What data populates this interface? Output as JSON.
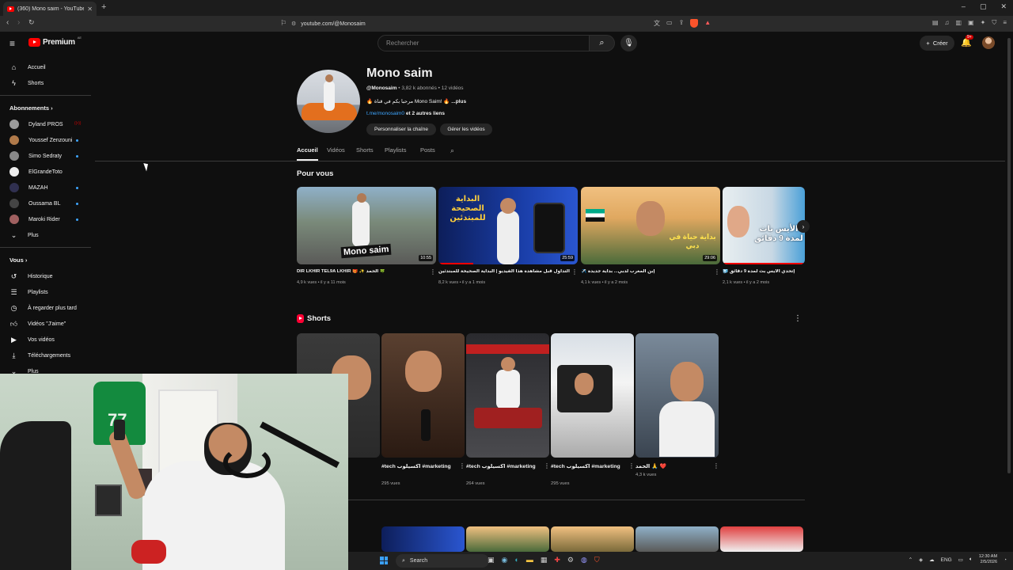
{
  "browser": {
    "tab_title": "(360) Mono saim - YouTube",
    "url": "youtube.com/@Monosaim",
    "notif_badge": "9+"
  },
  "header": {
    "logo_word": "Premium",
    "logo_country": "AE",
    "search_placeholder": "Rechercher",
    "create_label": "Créer",
    "bell_badge": "9+"
  },
  "sidebar": {
    "home": "Accueil",
    "shorts": "Shorts",
    "subscriptions_title": "Abonnements",
    "channels": [
      {
        "name": "Dyland PROS",
        "status": "live"
      },
      {
        "name": "Youssef Zenzouni",
        "status": "dot"
      },
      {
        "name": "Simo Sedraty",
        "status": "dot"
      },
      {
        "name": "ElGrandeToto",
        "status": "none"
      },
      {
        "name": "MAZAH",
        "status": "dot"
      },
      {
        "name": "Oussama BL",
        "status": "dot"
      },
      {
        "name": "Maroki Rider",
        "status": "dot"
      }
    ],
    "more_subs": "Plus",
    "you_title": "Vous",
    "you_items": [
      "Historique",
      "Playlists",
      "À regarder plus tard",
      "Vidéos \"J'aime\"",
      "Vos vidéos",
      "Téléchargements"
    ],
    "more_you": "Plus"
  },
  "channel": {
    "name": "Mono saim",
    "handle": "@Monosaim",
    "subs": "3,82 k abonnés",
    "videos": "12 vidéos",
    "desc": "مرحبا بكم في قناة Mono Saim!",
    "more": "...plus",
    "link": "t.me/monosaim0",
    "other_links": "et 2 autres liens",
    "btn_customize": "Personnaliser la chaîne",
    "btn_manage": "Gérer les vidéos",
    "tabs": [
      "Accueil",
      "Vidéos",
      "Shorts",
      "Playlists",
      "Posts"
    ]
  },
  "for_you": {
    "title": "Pour vous",
    "videos": [
      {
        "title": "DIR LKHIR TEL9A LKHIR 🎁 ✨ الحمد 🍀",
        "meta": "4,9 k vues • il y a 11 mois",
        "duration": "10:55",
        "progress": 0.0,
        "thumb_text": "Mono saim"
      },
      {
        "title": "لا تبدأ التداول قبل مشاهدة هذا الفيديو | البداية الصحيحة للمبتدئين",
        "meta": "8,2 k vues • il y a 1 mois",
        "duration": "25:59",
        "progress": 0.25,
        "thumb_text": "البداية الصحيحة للمبتدئين"
      },
      {
        "title": "✈️ إبن المغرب لدبي... بداية جديدة",
        "meta": "4,1 k vues • il y a 2 mois",
        "duration": "29:06",
        "progress": 0.0,
        "thumb_text": "بداية حياة في دبي"
      },
      {
        "title": "🧊 إتحدي الأيس بث لمدة 9 دقائق",
        "meta": "2,1 k vues • il y a 2 mois",
        "duration": "",
        "progress": 0.0,
        "thumb_text": "الأيس باث لمدة 9 دقائق"
      }
    ]
  },
  "shorts": {
    "title": "Shorts",
    "items": [
      {
        "title": "",
        "views": ""
      },
      {
        "title": "#tech اكسيلوب #marketing",
        "views": "295 vues"
      },
      {
        "title": "#tech اكسيلوب #marketing",
        "views": "264 vues"
      },
      {
        "title": "#tech اكسيلوب #marketing",
        "views": "295 vues"
      },
      {
        "title": "الحمد 🙏 ❤️",
        "views": "4,3 k vues"
      }
    ]
  },
  "taskbar": {
    "search": "Search",
    "lang": "ENG",
    "time": "12:30 AM",
    "date": "2/5/2026"
  },
  "colors": {
    "bg": "#0f0f0f",
    "accent_red": "#ff0000",
    "link_blue": "#3ea6ff"
  }
}
